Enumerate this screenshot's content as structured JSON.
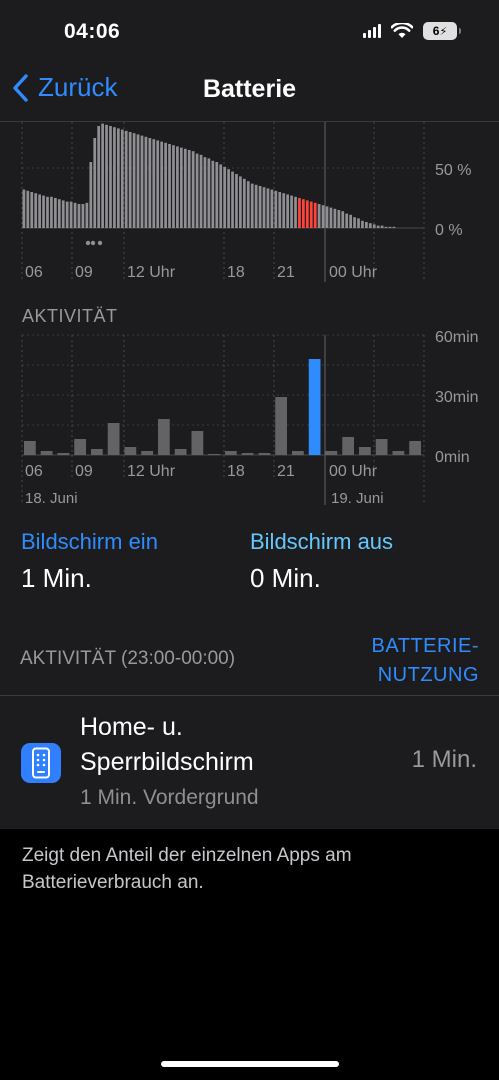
{
  "status_bar": {
    "time": "04:06",
    "battery": "6",
    "icons": [
      "signal-icon",
      "wifi-icon",
      "battery-charging-icon"
    ]
  },
  "nav": {
    "back_label": "Zurück",
    "title": "Batterie"
  },
  "battery_chart": {
    "y_ticks": [
      "50 %",
      "0 %"
    ],
    "x_ticks": [
      "06",
      "09",
      "12 Uhr",
      "18",
      "21",
      "00 Uhr"
    ]
  },
  "activity_chart": {
    "section_label": "AKTIVITÄT",
    "y_ticks": [
      "60min",
      "30min",
      "0min"
    ],
    "x_ticks": [
      "06",
      "09",
      "12 Uhr",
      "18",
      "21",
      "00 Uhr"
    ],
    "dates": [
      "18. Juni",
      "19. Juni"
    ]
  },
  "chart_data": [
    {
      "type": "bar",
      "ylim": [
        0,
        100
      ],
      "values": [
        32,
        31,
        30,
        29,
        28,
        27,
        26,
        26,
        25,
        24,
        23,
        22,
        22,
        21,
        20,
        20,
        21,
        55,
        75,
        85,
        87,
        86,
        85,
        84,
        83,
        82,
        81,
        80,
        79,
        78,
        77,
        76,
        75,
        74,
        73,
        72,
        71,
        70,
        69,
        68,
        67,
        66,
        65,
        64,
        62,
        61,
        59,
        58,
        56,
        55,
        53,
        51,
        49,
        47,
        45,
        43,
        41,
        39,
        37,
        36,
        35,
        34,
        33,
        32,
        31,
        30,
        29,
        28,
        27,
        26,
        25,
        24,
        23,
        22,
        21,
        20,
        19,
        18,
        17,
        16,
        15,
        14,
        12,
        11,
        9,
        8,
        6,
        5,
        4,
        3,
        2,
        2,
        1,
        1,
        1
      ],
      "highlighted_range": [
        70,
        74
      ],
      "colors": {
        "bar": "#8e8e93",
        "highlight": "#ff453a"
      }
    },
    {
      "type": "bar",
      "ylim": [
        0,
        60
      ],
      "values": [
        7,
        2,
        1,
        8,
        3,
        16,
        4,
        2,
        18,
        3,
        12,
        0,
        2,
        1,
        1,
        29,
        2,
        48,
        2,
        9,
        4,
        8,
        2,
        7,
        1
      ],
      "colors": {
        "bar": "#636366",
        "highlight": "#2f8cff"
      }
    }
  ],
  "screen": {
    "on_label": "Bildschirm ein",
    "on_value": "1 Min.",
    "off_label": "Bildschirm aus",
    "off_value": "0 Min."
  },
  "activity": {
    "header": "AKTIVITÄT (23:00-00:00)",
    "usage_link_line1": "BATTERIE-",
    "usage_link_line2": "NUTZUNG"
  },
  "app": {
    "name_line1": "Home- u.",
    "name_line2": "Sperrbildschirm",
    "subtitle": "1 Min. Vordergrund",
    "time": "1 Min."
  },
  "footer": "Zeigt den Anteil der einzelnen Apps am Batterieverbrauch an."
}
